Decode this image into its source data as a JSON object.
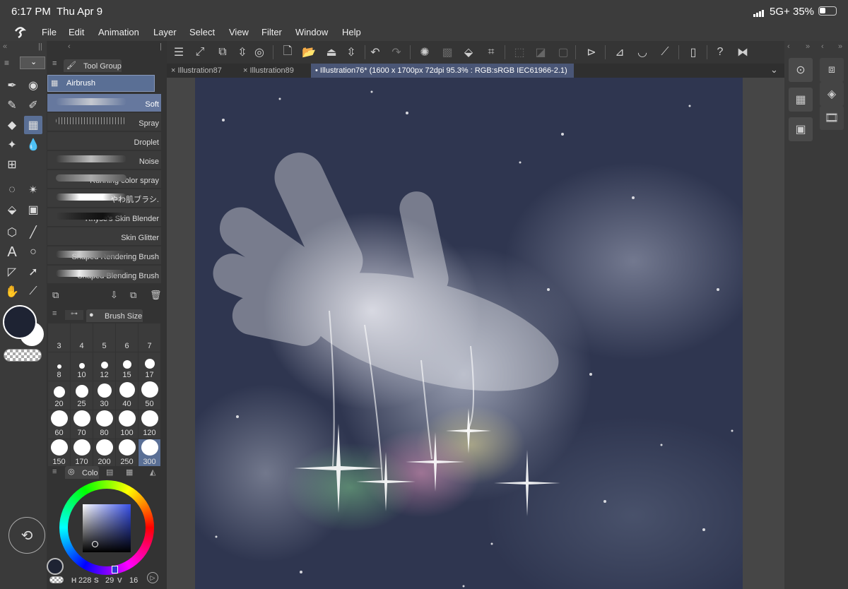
{
  "status_bar": {
    "time": "6:17 PM",
    "date": "Thu Apr 9",
    "network": "5G+",
    "battery": "35%"
  },
  "menu": {
    "items": [
      "File",
      "Edit",
      "Animation",
      "Layer",
      "Select",
      "View",
      "Filter",
      "Window",
      "Help"
    ]
  },
  "tabs": [
    {
      "label": "Illustration87"
    },
    {
      "label": "Illustration89"
    },
    {
      "label": "Illustration76* (1600 x 1700px 72dpi 95.3% : RGB:sRGB IEC61966-2.1)"
    }
  ],
  "tool_panel": {
    "tab_label": "Tool Group",
    "group_label": "Airbrush",
    "brushes": [
      "Soft",
      "Spray",
      "Droplet",
      "Noise",
      "Running color spray",
      "やわ肌ブラシ.",
      "Rhyse's Skin Blender",
      "Skin Glitter",
      "Shaped Rendering Brush",
      "Shaped Blending  Brush"
    ]
  },
  "brush_size": {
    "tab_label": "Brush Size",
    "sizes": [
      "3",
      "4",
      "5",
      "6",
      "7",
      "8",
      "10",
      "12",
      "15",
      "17",
      "20",
      "25",
      "30",
      "40",
      "50",
      "60",
      "70",
      "80",
      "100",
      "120",
      "150",
      "170",
      "200",
      "250",
      "300"
    ],
    "selected": "300"
  },
  "color_panel": {
    "tab_label": "Colo",
    "h_label": "H",
    "h_value": "228",
    "s_label": "S",
    "s_value": "29",
    "v_label": "V",
    "v_value": "16",
    "main_color": "#1e2333",
    "sub_color": "#ffffff",
    "accent_color": "#4a5676"
  },
  "icons": {
    "app_logo": "clip-studio-logo-icon",
    "left_tools": [
      "pen-icon",
      "airbrush-dropper-icon",
      "pencil-icon",
      "g-pen-icon",
      "eraser-icon",
      "airbrush-icon",
      "sparkle-icon",
      "blend-drop-icon",
      "mesh-icon",
      "lasso-icon",
      "auto-select-icon",
      "fill-bucket-icon",
      "gradient-icon",
      "3d-object-icon",
      "line-icon",
      "text-icon",
      "balloon-icon",
      "frame-icon",
      "operation-icon",
      "hand-icon",
      "eyedropper-icon"
    ],
    "right_panel": [
      "navigator-icon",
      "layer-icon",
      "material-icon",
      "animation-icon",
      "save-icon"
    ]
  }
}
